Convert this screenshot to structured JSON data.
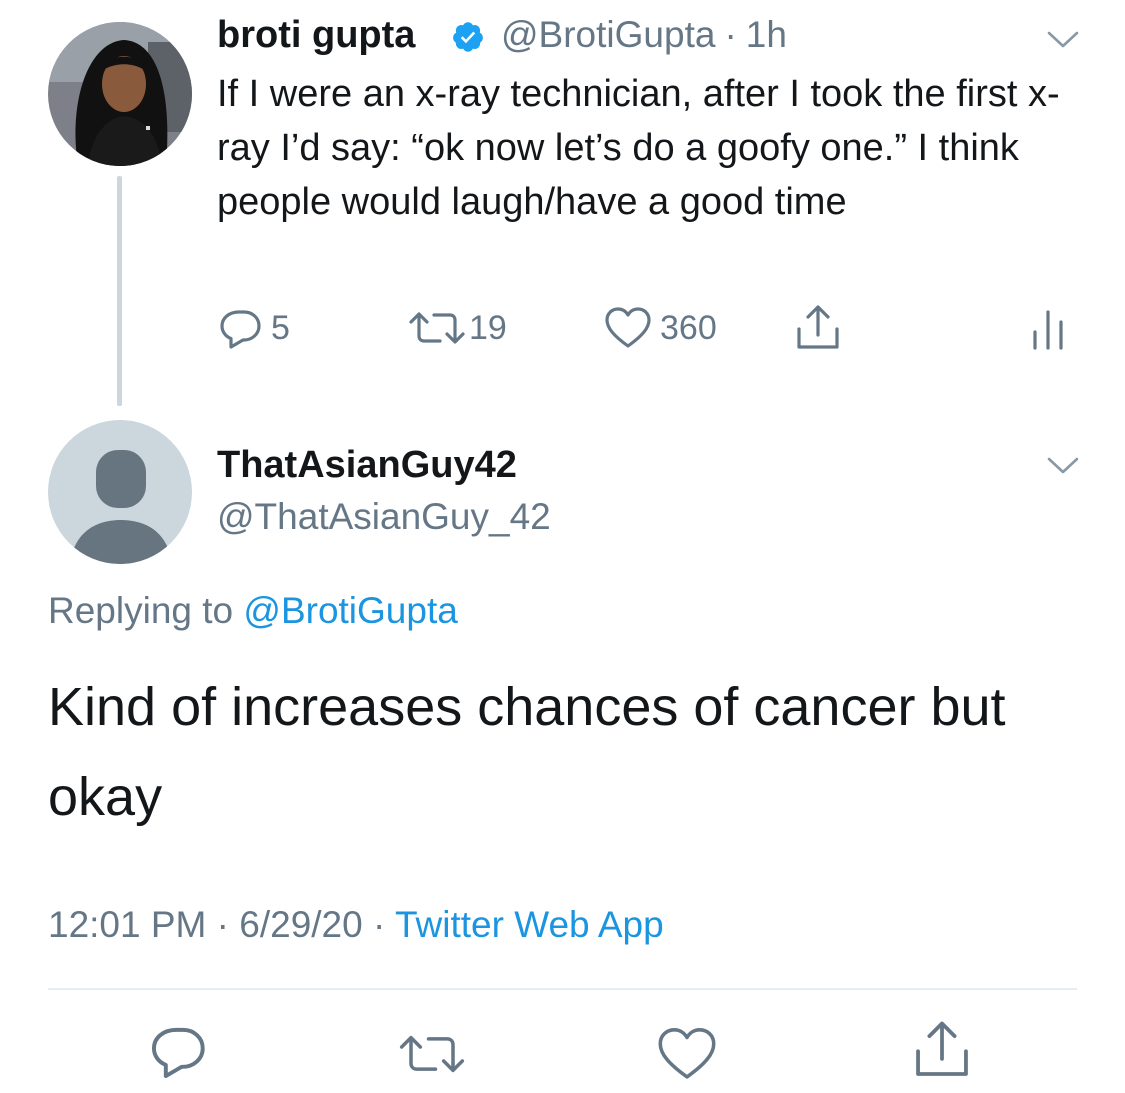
{
  "original_tweet": {
    "display_name": "broti gupta",
    "handle": "@BrotiGupta",
    "separator": "·",
    "age": "1h",
    "text": "If I were an x-ray technician, after I took the first x-ray I’d say: “ok now let’s do a goofy one.” I think people would laugh/have a good time",
    "stats": {
      "replies": "5",
      "retweets": "19",
      "likes": "360"
    }
  },
  "reply_tweet": {
    "display_name": "ThatAsianGuy42",
    "handle": "@ThatAsianGuy_42",
    "replying_prefix": "Replying to",
    "replying_to": "@BrotiGupta",
    "text": "Kind of increases chances of cancer but okay",
    "time": "12:01 PM",
    "date": "6/29/20",
    "separator": "·",
    "source": "Twitter Web App"
  },
  "icons": {
    "verified": "verified-badge-icon",
    "menu": "chevron-down-icon",
    "reply": "speech-bubble-icon",
    "retweet": "retweet-arrows-icon",
    "like": "heart-icon",
    "share": "share-upload-icon",
    "analytics": "analytics-bars-icon"
  },
  "colors": {
    "text": "#14171a",
    "secondary": "#657786",
    "link": "#1b95e0",
    "verified": "#1da1f2",
    "thread_line": "#cdd6dd",
    "divider": "#e6ecf0"
  }
}
